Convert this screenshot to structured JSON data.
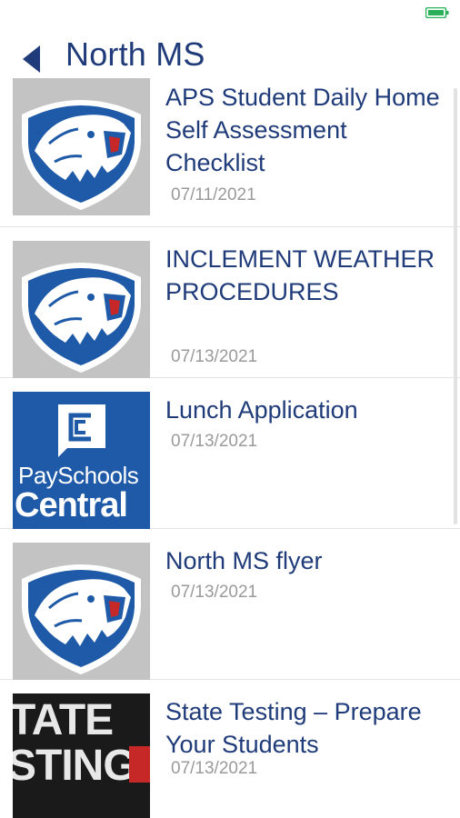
{
  "header": {
    "title": "North MS"
  },
  "colors": {
    "title": "#1f3b7a",
    "date": "#9a9a9a",
    "battery": "#2bb05a",
    "payschools": "#1e5aa8"
  },
  "items": [
    {
      "title": "APS Student Daily Home Self Assessment Checklist",
      "date": "07/11/2021",
      "thumbnail": "bear-logo"
    },
    {
      "title": "INCLEMENT WEATHER PROCEDURES",
      "date": "07/13/2021",
      "thumbnail": "bear-logo"
    },
    {
      "title": "Lunch Application",
      "date": "07/13/2021",
      "thumbnail": "payschools-logo",
      "logo_text_1": "PaySchools",
      "logo_text_2": "Central"
    },
    {
      "title": "North MS flyer",
      "date": "07/13/2021",
      "thumbnail": "bear-logo"
    },
    {
      "title": "State Testing – Prepare Your Students",
      "date": "07/13/2021",
      "thumbnail": "state-testing-image",
      "image_text_1": "TATE",
      "image_text_2": "STING"
    }
  ]
}
